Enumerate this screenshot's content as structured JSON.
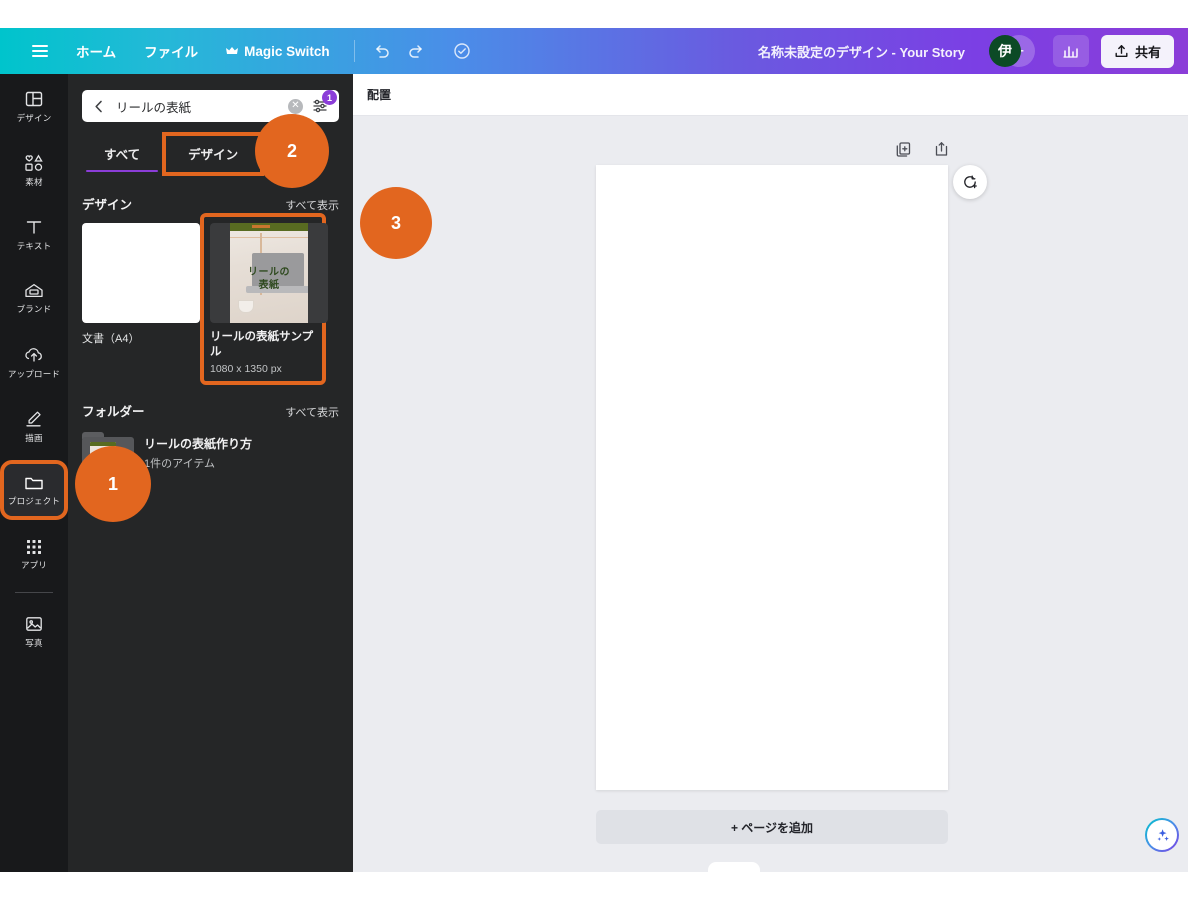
{
  "topbar": {
    "menu_icon": "hamburger-icon",
    "home_label": "ホーム",
    "file_label": "ファイル",
    "magic_switch_label": "Magic Switch",
    "magic_switch_icon": "crown-icon",
    "undo_icon": "undo-icon",
    "redo_icon": "redo-icon",
    "cloud_status_icon": "cloud-check-icon",
    "doc_title": "名称未設定のデザイン - Your Story",
    "avatar_initial": "伊",
    "invite_label": "+",
    "insights_icon": "bar-chart-icon",
    "share_label": "共有",
    "share_icon": "upload-icon",
    "gradient_start": "#00c4cc",
    "gradient_end": "#8b3dd8"
  },
  "rail": {
    "items": [
      {
        "label": "デザイン",
        "icon": "layout-icon",
        "highlighted": false
      },
      {
        "label": "素材",
        "icon": "shapes-icon",
        "highlighted": false
      },
      {
        "label": "テキスト",
        "icon": "text-t-icon",
        "highlighted": false
      },
      {
        "label": "ブランド",
        "icon": "brand-icon",
        "highlighted": false
      },
      {
        "label": "アップロード",
        "icon": "cloud-upload-icon",
        "highlighted": false
      },
      {
        "label": "描画",
        "icon": "pen-icon",
        "highlighted": false
      },
      {
        "label": "プロジェクト",
        "icon": "folder-icon",
        "highlighted": true
      },
      {
        "label": "アプリ",
        "icon": "apps-grid-icon",
        "highlighted": false
      },
      {
        "label": "写真",
        "icon": "photo-icon",
        "highlighted": false
      }
    ]
  },
  "panel": {
    "search": {
      "back_icon": "chevron-left-icon",
      "value": "リールの表紙",
      "placeholder": "検索",
      "clear_icon": "clear-circle-icon",
      "filter_icon": "filter-sliders-icon",
      "filter_badge": "1"
    },
    "tabs": [
      {
        "label": "すべて",
        "active": true,
        "highlighted": false
      },
      {
        "label": "デザイン",
        "active": false,
        "highlighted": true
      }
    ],
    "design_section": {
      "title": "デザイン",
      "see_all": "すべて表示",
      "cards": [
        {
          "title": "",
          "meta": "文書（A4）",
          "subtitle": "",
          "highlighted": false,
          "thumb": "blank-white"
        },
        {
          "title": "リールの表紙サンプル",
          "meta": "",
          "subtitle": "1080 x 1350 px",
          "highlighted": true,
          "thumb": "reel-cover",
          "thumb_text": "リールの\n表紙"
        }
      ]
    },
    "folder_section": {
      "title": "フォルダー",
      "see_all": "すべて表示",
      "folders": [
        {
          "name": "リールの表紙作り方",
          "count": "1件のアイテム",
          "icon": "folder-thumb-icon"
        }
      ]
    },
    "collapse_icon": "chevron-left-icon"
  },
  "editor": {
    "toolbar_label": "配置",
    "duplicate_page_icon": "duplicate-page-icon",
    "add_page_icon": "add-page-icon",
    "refresh_icon": "magic-refresh-icon",
    "add_page_label": "+ ページを追加",
    "ai_icon": "sparkle-icon"
  },
  "annotations": [
    {
      "number": "1",
      "target": "プロジェクト",
      "color": "#e2661f"
    },
    {
      "number": "2",
      "target": "デザイン タブ",
      "color": "#e2661f"
    },
    {
      "number": "3",
      "target": "リールの表紙サンプル",
      "color": "#e2661f"
    }
  ]
}
